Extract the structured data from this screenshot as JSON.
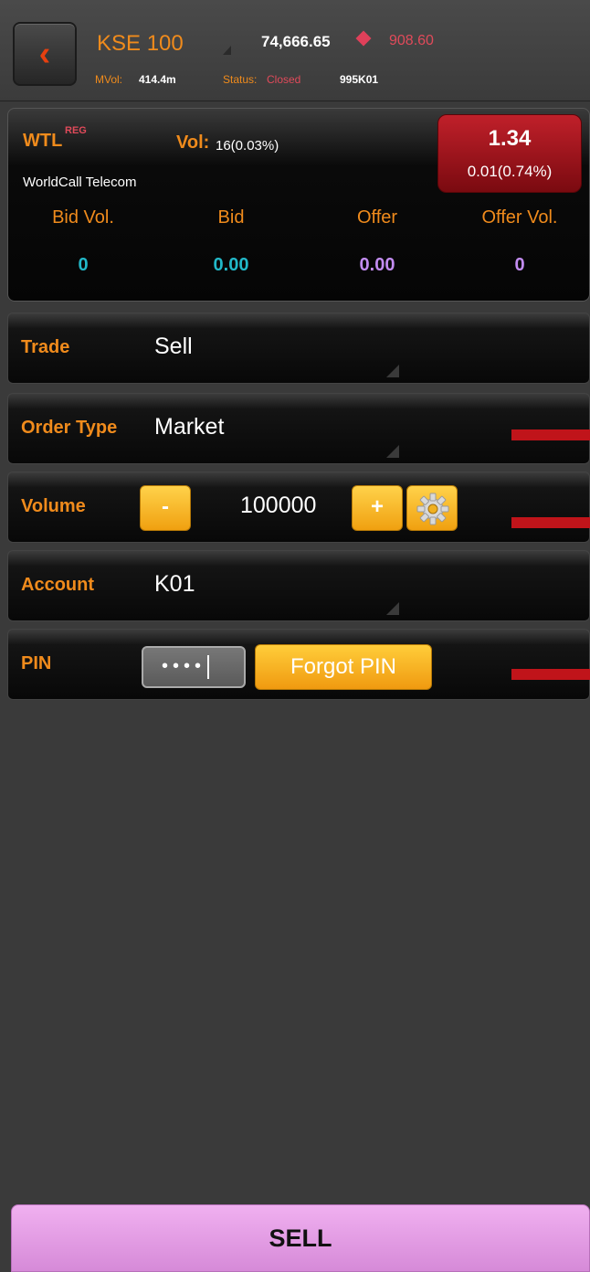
{
  "header": {
    "index_name": "KSE 100",
    "index_value": "74,666.65",
    "index_change": "908.60",
    "mval_label": "MVol:",
    "mval_value": "414.4m",
    "status_label": "Status:",
    "status_value": "Closed",
    "account_code": "995K01"
  },
  "quote": {
    "symbol": "WTL",
    "reg": "REG",
    "vol_label": "Vol:",
    "vol_value": "16(0.03%)",
    "company": "WorldCall Telecom",
    "price": "1.34",
    "price_change": "0.01(0.74%)",
    "columns": [
      "Bid Vol.",
      "Bid",
      "Offer",
      "Offer Vol."
    ],
    "values": [
      "0",
      "0.00",
      "0.00",
      "0"
    ]
  },
  "form": {
    "trade_label": "Trade",
    "trade_value": "Sell",
    "order_type_label": "Order Type",
    "order_type_value": "Market",
    "volume_label": "Volume",
    "volume_minus": "-",
    "volume_value": "100000",
    "volume_plus": "+",
    "account_label": "Account",
    "account_value": "K01",
    "pin_label": "PIN",
    "pin_value": "••••",
    "forgot_pin": "Forgot PIN"
  },
  "action": {
    "sell_label": "SELL"
  },
  "colors": {
    "accent": "#f08b1c",
    "down": "#e04a5a",
    "sell": "#e0a0e2"
  }
}
